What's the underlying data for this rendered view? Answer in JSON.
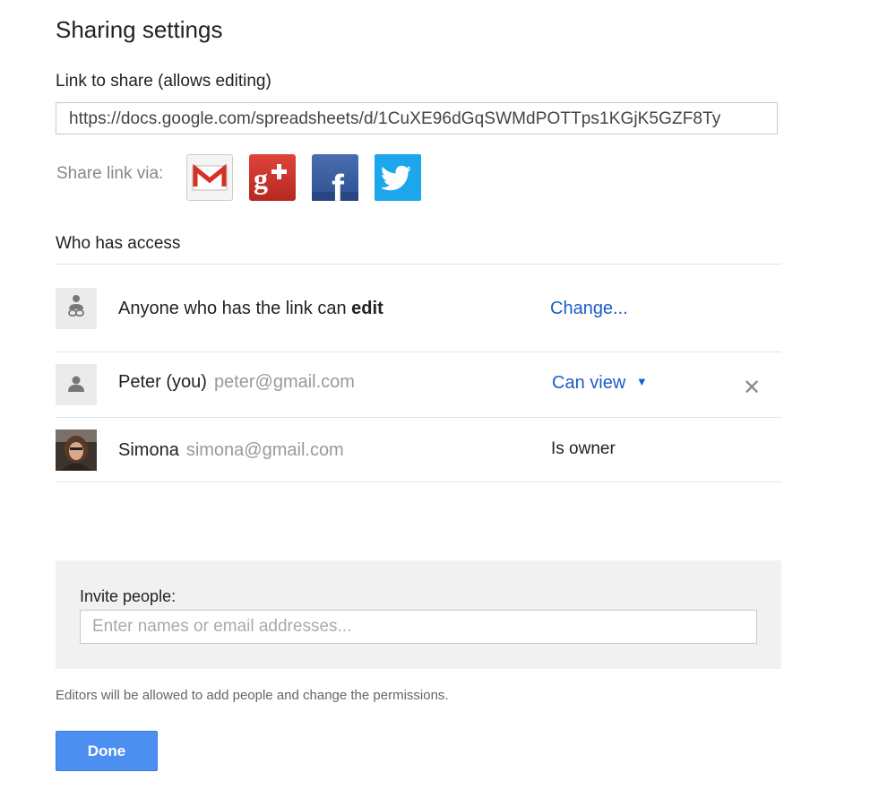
{
  "dialog": {
    "title": "Sharing settings",
    "link_label": "Link to share (allows editing)",
    "link_url": "https://docs.google.com/spreadsheets/d/1CuXE96dGqSWMdPOTTps1KGjK5GZF8Ty",
    "share_via_label": "Share link via:",
    "share_services": [
      "gmail-icon",
      "google-plus-icon",
      "facebook-icon",
      "twitter-icon"
    ]
  },
  "access": {
    "title": "Who has access",
    "link_row": {
      "text_prefix": "Anyone who has the link can ",
      "text_bold": "edit",
      "change_label": "Change..."
    },
    "people": [
      {
        "name": "Peter (you)",
        "email": "peter@gmail.com",
        "permission": "Can view"
      },
      {
        "name": "Simona",
        "email": "simona@gmail.com",
        "permission": "Is owner"
      }
    ]
  },
  "invite": {
    "label": "Invite people:",
    "placeholder": "Enter names or email addresses..."
  },
  "note": "Editors will be allowed to add people and change the permissions.",
  "done_label": "Done",
  "colors": {
    "link_blue": "#1a5dc9",
    "button_blue": "#4d8ff0",
    "panel_gray": "#f1f1f1"
  }
}
